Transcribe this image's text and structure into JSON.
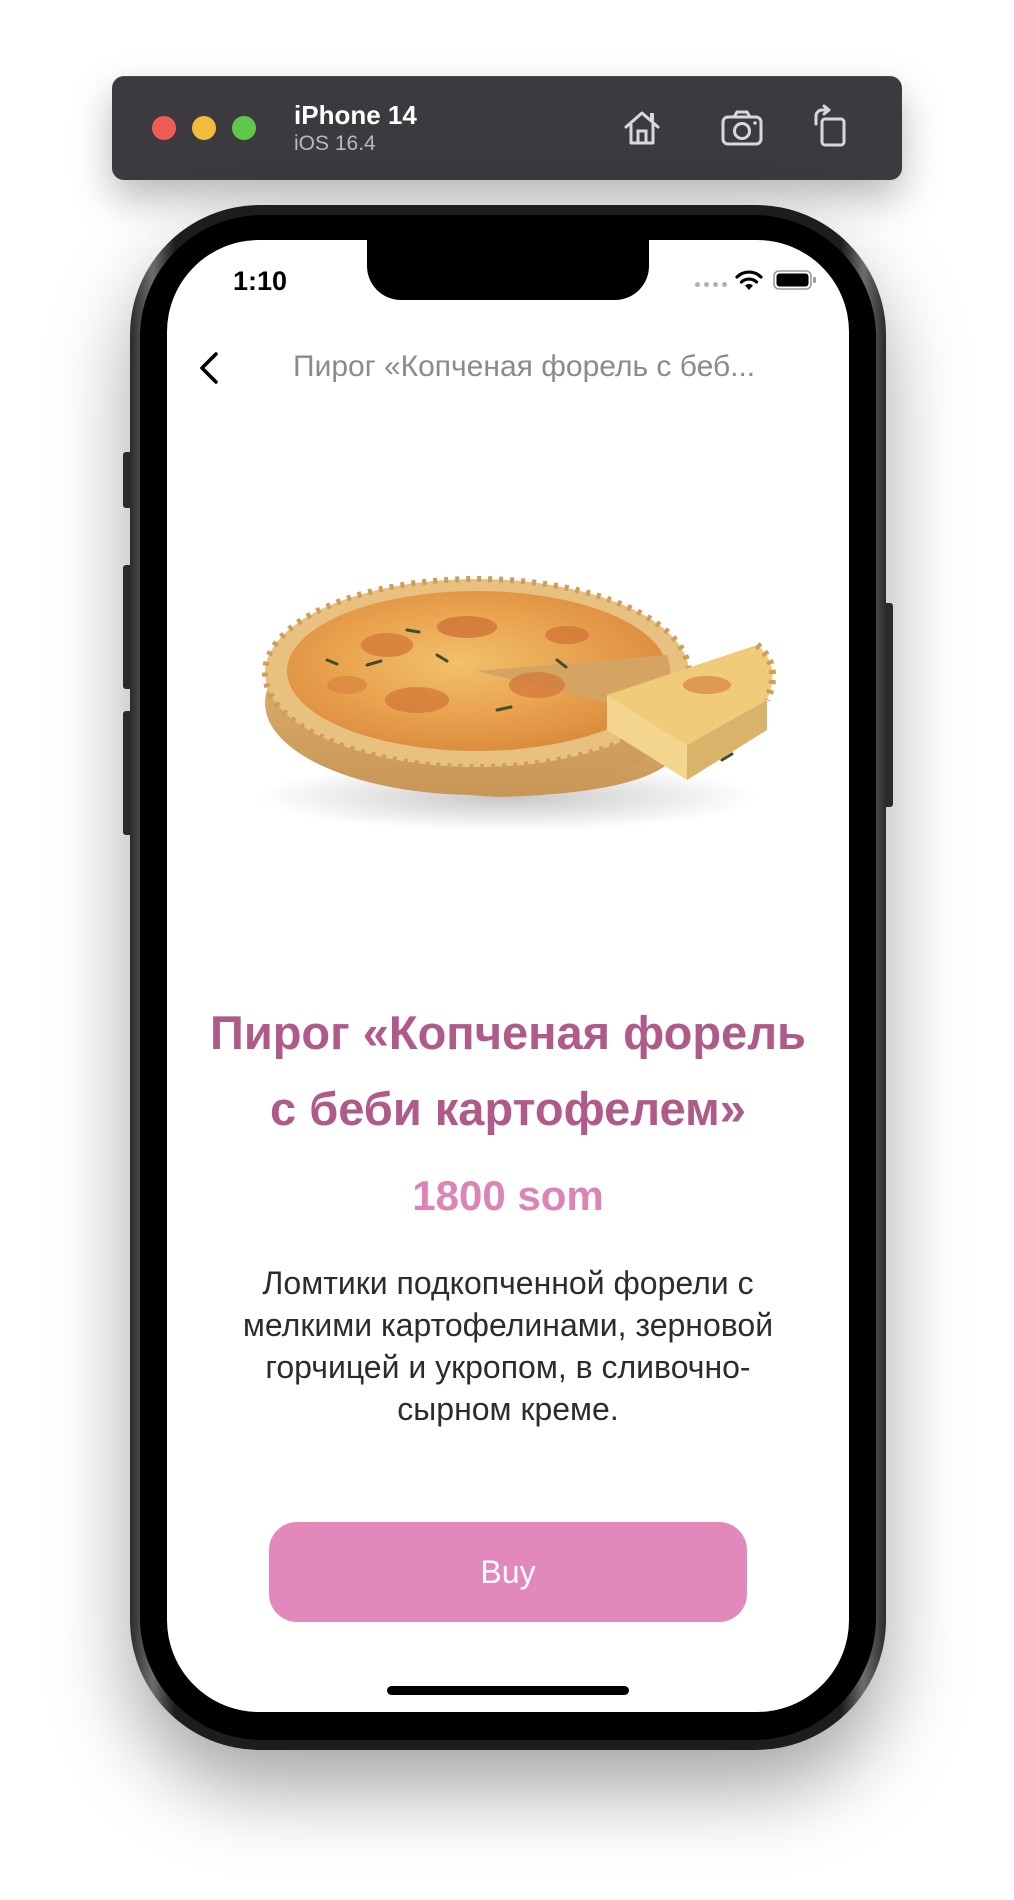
{
  "simulator": {
    "device_name": "iPhone 14",
    "os_version": "iOS 16.4",
    "icons": [
      "home-icon",
      "screenshot-icon",
      "rotate-icon"
    ]
  },
  "status_bar": {
    "time": "1:10",
    "icons": [
      "wifi-icon",
      "battery-icon"
    ]
  },
  "nav": {
    "back_icon": "chevron-left-icon",
    "title": "Пирог «Копченая форель с беб..."
  },
  "product": {
    "image_icon": "pie-image",
    "title_lines": [
      "Пирог «Копченая форель",
      "с беби картофелем»"
    ],
    "price": "1800 som",
    "description_lines": [
      "Ломтики подкопченной форели с",
      "мелкими картофелинами, зерновой",
      "горчицей и укропом, в сливочно-",
      "сырном креме."
    ],
    "buy_label": "Buy"
  },
  "colors": {
    "title": "#b05a8a",
    "price": "#de83b6",
    "button": "#e388ba",
    "nav_title": "#8a8a8f"
  }
}
